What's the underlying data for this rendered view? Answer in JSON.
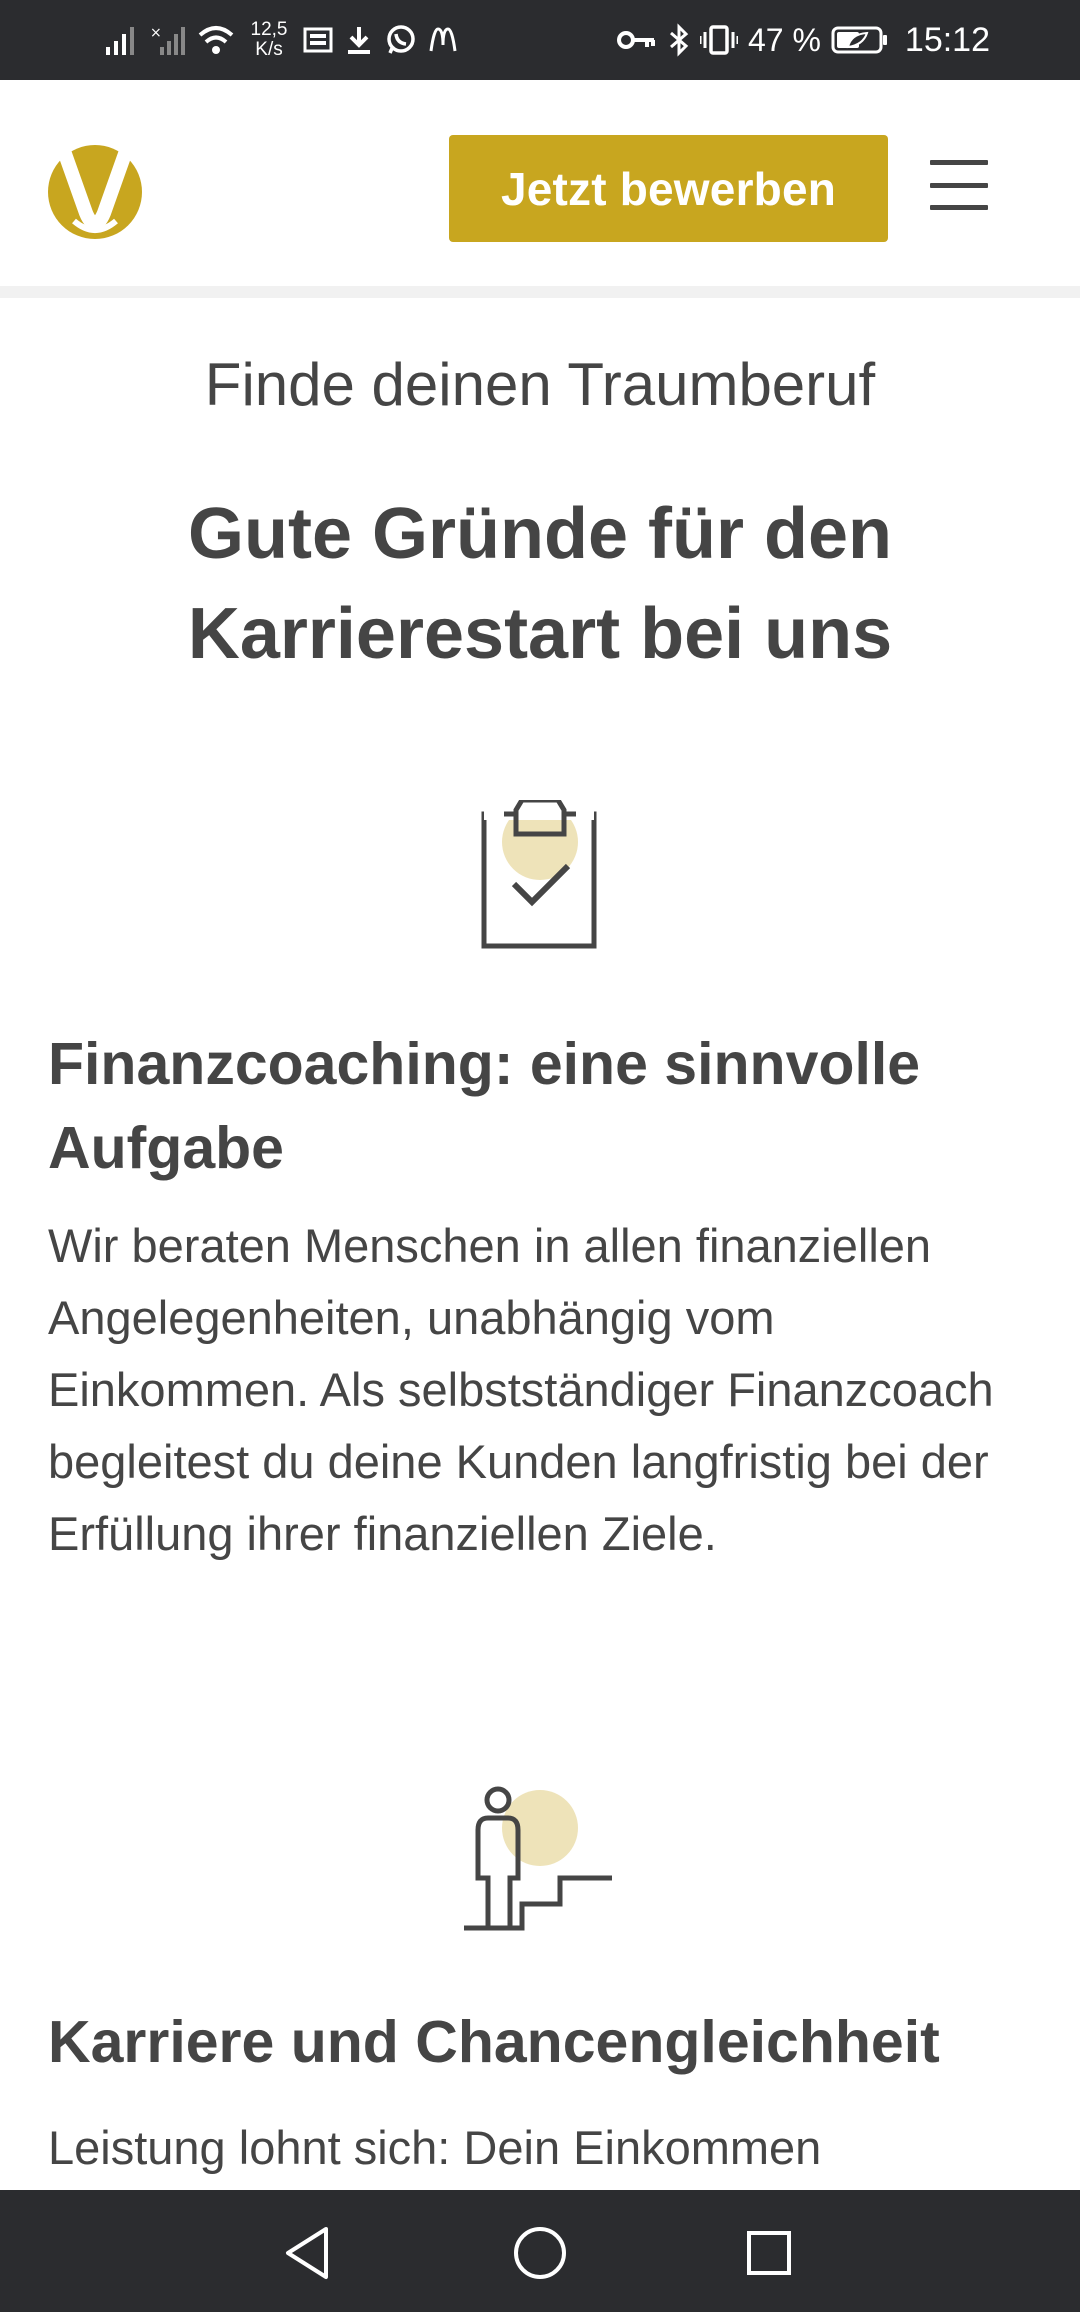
{
  "status_bar": {
    "network_speed_value": "12,5",
    "network_speed_unit": "K/s",
    "battery_percent": "47 %",
    "time": "15:12",
    "icons": [
      "signal-icon",
      "signal-no-service-icon",
      "wifi-icon",
      "screen-icon",
      "download-icon",
      "whatsapp-icon",
      "mcdonalds-icon",
      "key-icon",
      "bluetooth-icon",
      "vibrate-icon",
      "battery-icon"
    ]
  },
  "header": {
    "logo_icon": "dvag-logo-icon",
    "apply_button_label": "Jetzt bewerben",
    "menu_icon": "hamburger-menu-icon",
    "brand_color": "#c8a61f"
  },
  "main": {
    "subtitle": "Finde deinen Traumberuf",
    "headline": "Gute Gründe für den Karrierestart bei uns",
    "features": [
      {
        "icon": "clipboard-check-icon",
        "title": "Finanzcoaching: eine sinnvolle Aufgabe",
        "text": "Wir beraten Menschen in allen finanziellen Angelegenheiten, unabhängig vom Einkommen. Als selbstständiger Finanzcoach begleitest du deine Kunden langfristig bei der Erfüllung ihrer finanziellen Ziele."
      },
      {
        "icon": "person-stairs-icon",
        "title": "Karriere und Chancengleichheit",
        "text": "Leistung lohnt sich: Dein Einkommen"
      }
    ]
  },
  "nav_bar": {
    "icons": [
      "back-icon",
      "home-icon",
      "recents-icon"
    ]
  }
}
